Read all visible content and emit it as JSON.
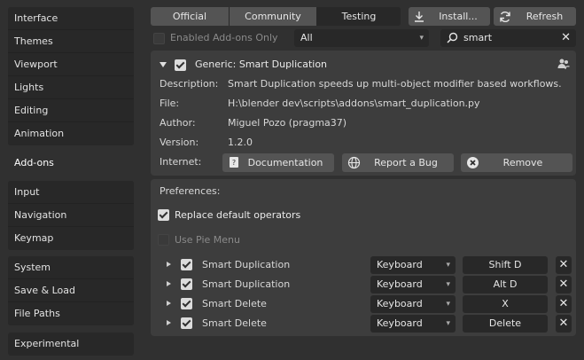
{
  "sidebar": {
    "group1": [
      "Interface",
      "Themes",
      "Viewport",
      "Lights",
      "Editing",
      "Animation"
    ],
    "active": "Add-ons",
    "group2": [
      "Input",
      "Navigation",
      "Keymap"
    ],
    "group3": [
      "System",
      "Save & Load",
      "File Paths"
    ],
    "experimental": "Experimental"
  },
  "tabs": {
    "official": "Official",
    "community": "Community",
    "testing": "Testing",
    "install": "Install...",
    "refresh": "Refresh"
  },
  "filter": {
    "enabled_only_label": "Enabled Add-ons Only",
    "enabled_only_checked": false,
    "category_value": "All",
    "search_value": "smart"
  },
  "addon": {
    "title": "Generic: Smart Duplication",
    "enabled": true,
    "fields": [
      {
        "key": "Description:",
        "value": "Smart Duplication speeds up multi-object modifier based workflows."
      },
      {
        "key": "File:",
        "value": "H:\\blender dev\\scripts\\addons\\smart_duplication.py"
      },
      {
        "key": "Author:",
        "value": "Miguel Pozo (pragma37)"
      },
      {
        "key": "Version:",
        "value": "1.2.0"
      }
    ],
    "internet_label": "Internet:",
    "documentation": "Documentation",
    "report_bug": "Report a Bug",
    "remove": "Remove"
  },
  "preferences": {
    "heading": "Preferences:",
    "replace_default_label": "Replace default operators",
    "replace_default_checked": true,
    "pie_menu_label": "Use Pie Menu",
    "pie_menu_checked": false,
    "keymap_rows": [
      {
        "name": "Smart Duplication",
        "device": "Keyboard",
        "key": "Shift D"
      },
      {
        "name": "Smart Duplication",
        "device": "Keyboard",
        "key": "Alt D"
      },
      {
        "name": "Smart Delete",
        "device": "Keyboard",
        "key": "X"
      },
      {
        "name": "Smart Delete",
        "device": "Keyboard",
        "key": "Delete"
      }
    ]
  },
  "colors": {
    "accent": "#4772b3",
    "panel": "#3d3d3d",
    "button": "#545454",
    "field": "#282828"
  }
}
